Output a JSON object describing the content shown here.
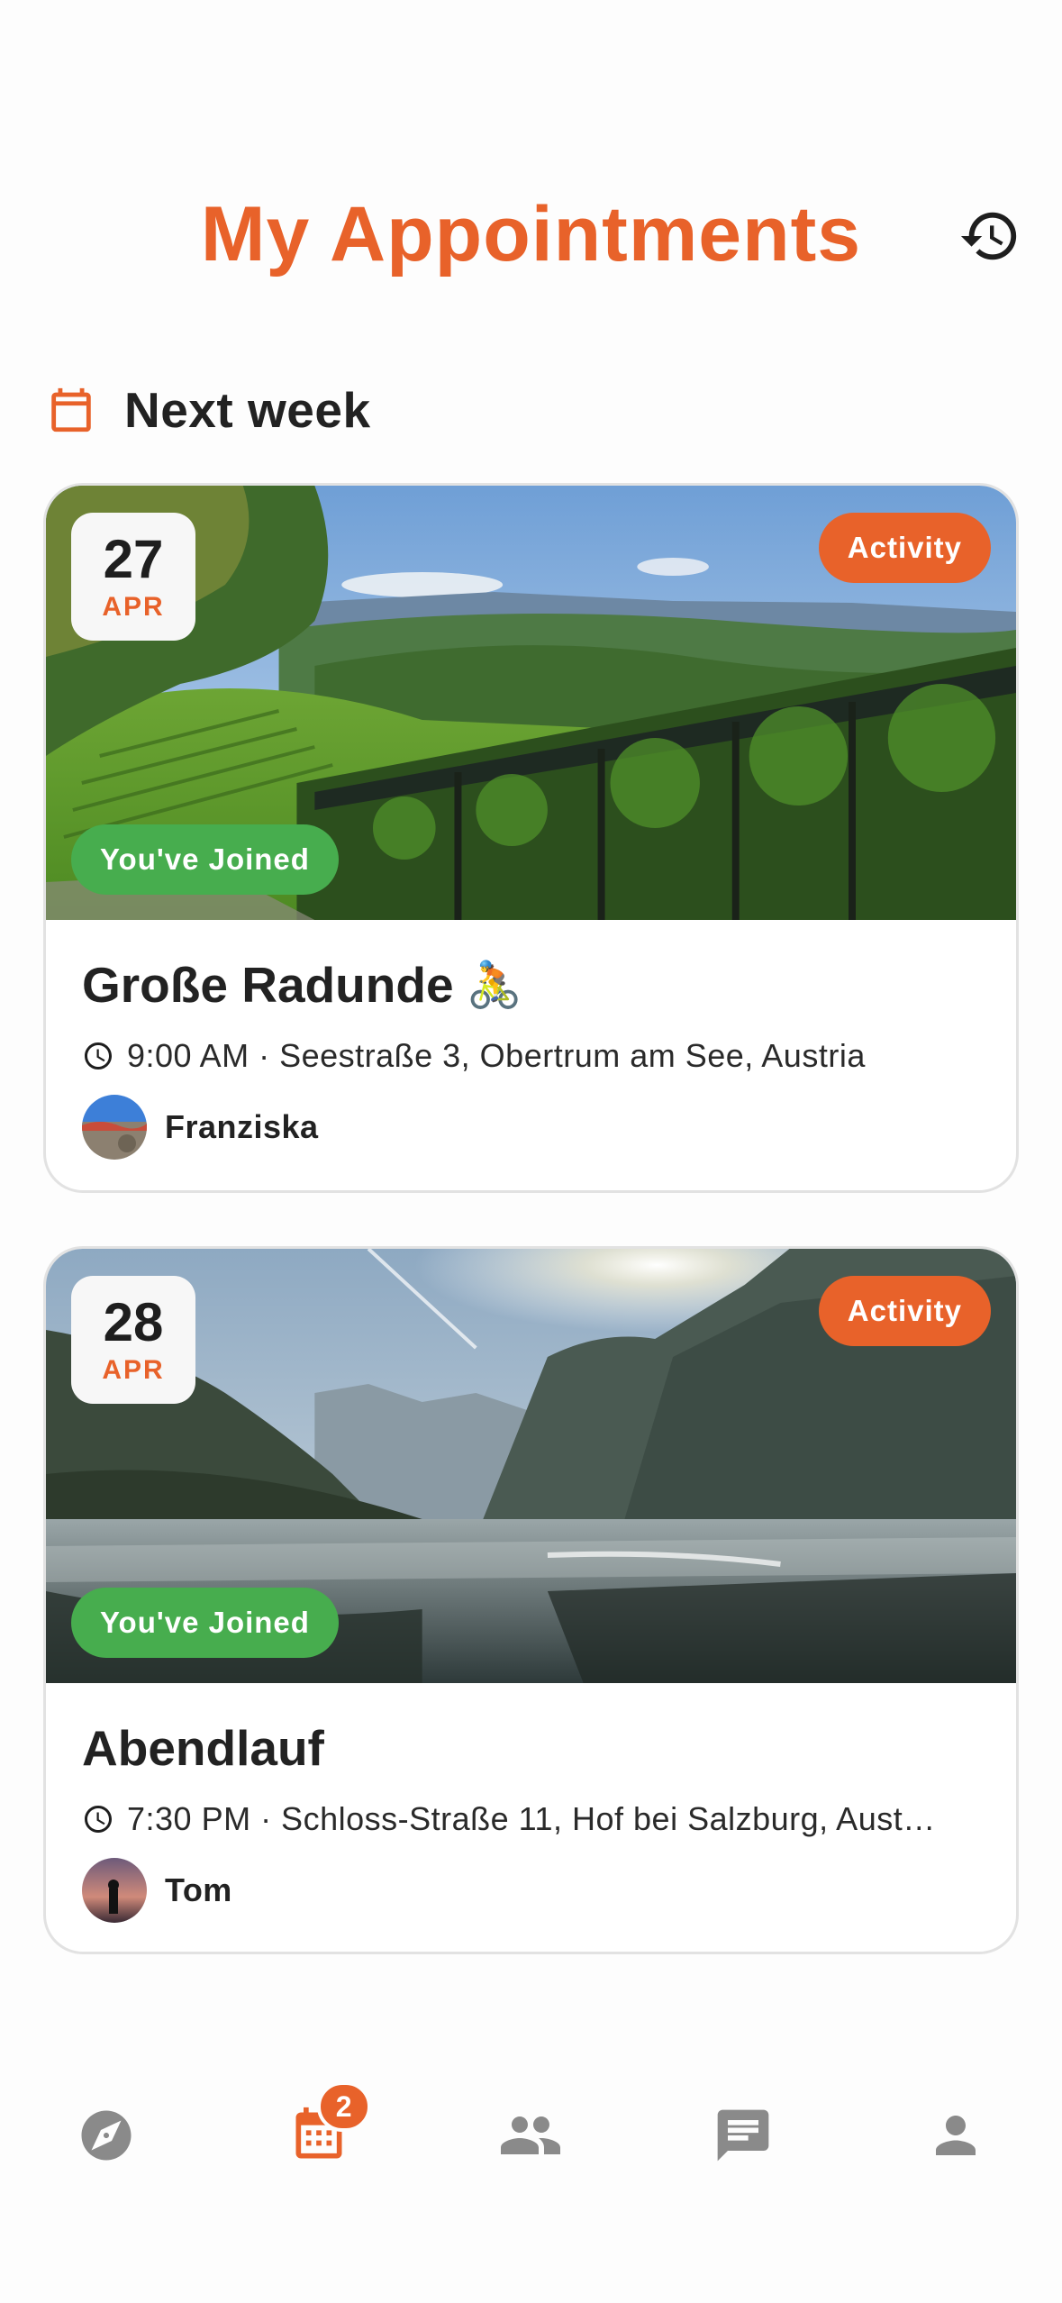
{
  "header": {
    "title": "My Appointments",
    "history_icon": "history-icon"
  },
  "section": {
    "title": "Next week",
    "icon": "calendar-icon"
  },
  "appointments": [
    {
      "day": "27",
      "month": "APR",
      "type": "Activity",
      "status": "You've Joined",
      "title": "Große Radunde",
      "emoji": "🚴",
      "meta": "9:00 AM · Seestraße 3, Obertrum am See, Austria",
      "host": "Franziska"
    },
    {
      "day": "28",
      "month": "APR",
      "type": "Activity",
      "status": "You've Joined",
      "title": "Abendlauf",
      "emoji": "",
      "meta": "7:30 PM · Schloss-Straße 11, Hof bei Salzburg, Aust…",
      "host": "Tom"
    }
  ],
  "nav": {
    "items": [
      "explore-icon",
      "calendar-icon",
      "group-icon",
      "chat-icon",
      "person-icon"
    ],
    "active": "calendar-icon",
    "calendar_badge": "2"
  },
  "colors": {
    "accent": "#e8622a",
    "joined": "#47ad4e",
    "nav_inactive": "#8a8a8a"
  }
}
